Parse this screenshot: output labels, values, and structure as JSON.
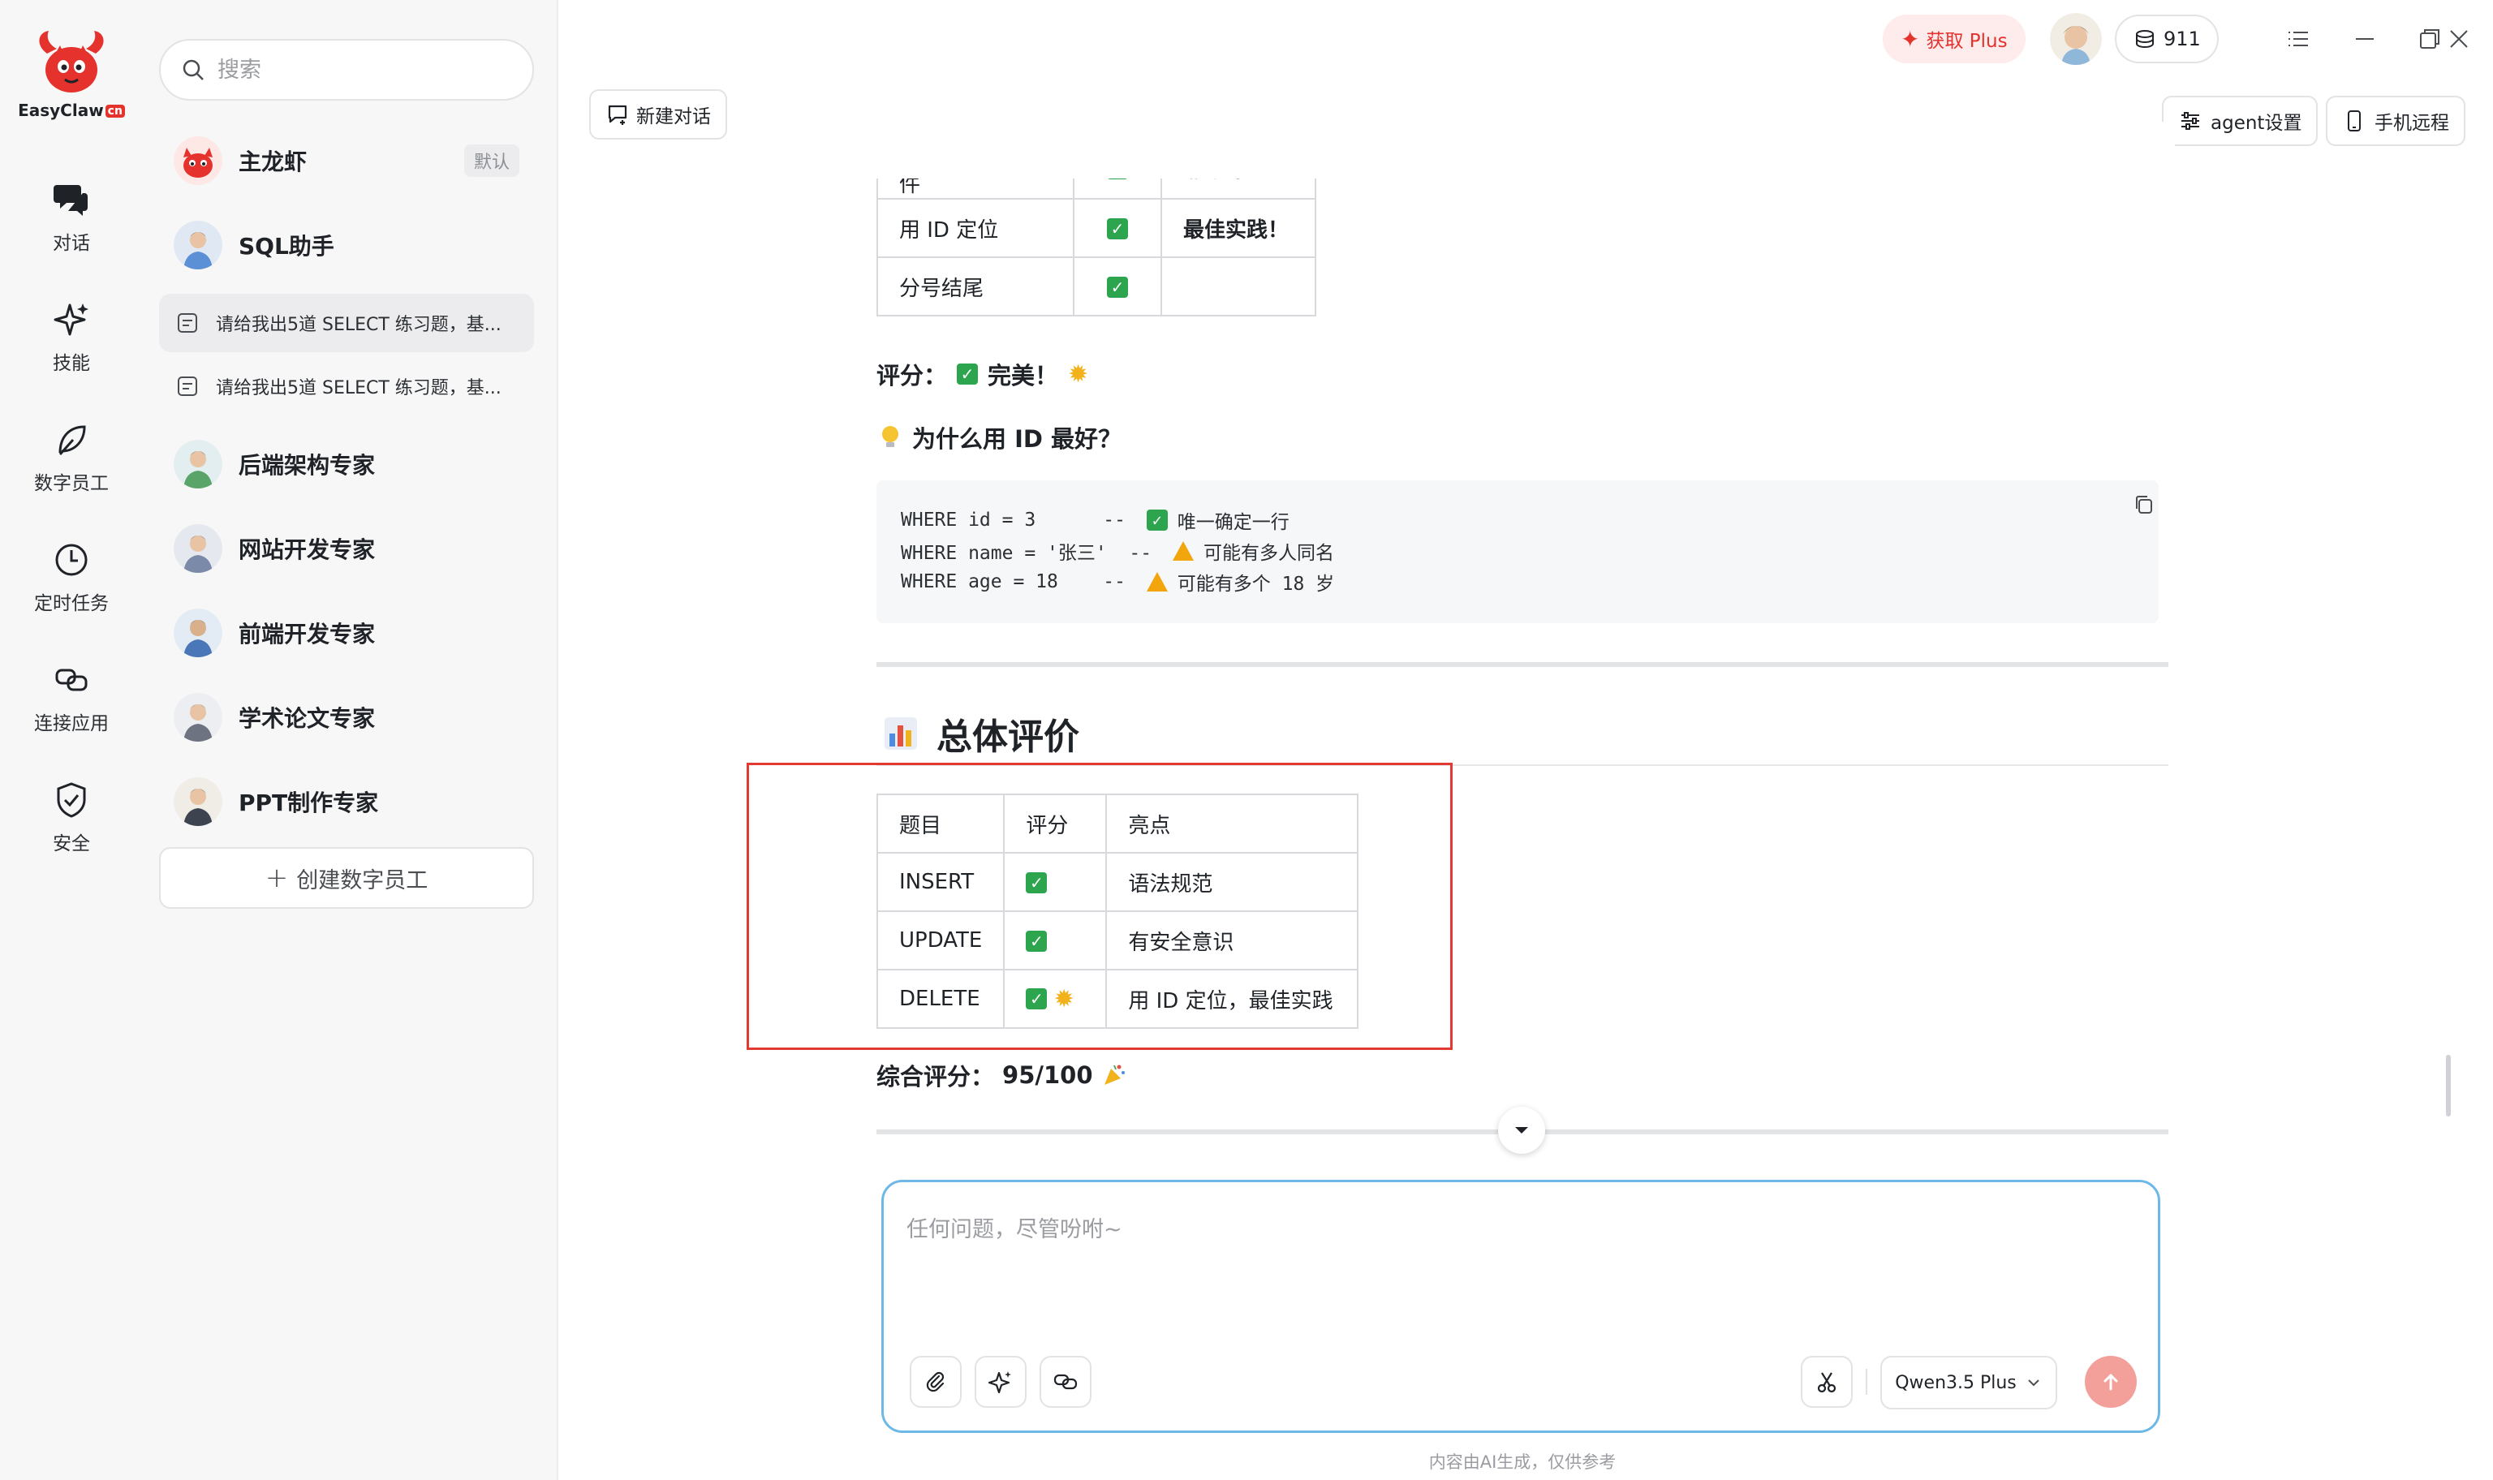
{
  "app": {
    "logo_text": "EasyClaw",
    "logo_badge": "cn"
  },
  "rail": {
    "items": [
      {
        "label": "对话",
        "icon": "chat-icon"
      },
      {
        "label": "技能",
        "icon": "sparkle-icon"
      },
      {
        "label": "数字员工",
        "icon": "leaf-icon"
      },
      {
        "label": "定时任务",
        "icon": "clock-icon"
      },
      {
        "label": "连接应用",
        "icon": "link-icon"
      },
      {
        "label": "安全",
        "icon": "shield-icon"
      }
    ]
  },
  "sidebar": {
    "search_placeholder": "搜索",
    "agents": [
      {
        "name": "主龙虾",
        "tag": "默认"
      },
      {
        "name": "SQL助手"
      },
      {
        "name": "后端架构专家"
      },
      {
        "name": "网站开发专家"
      },
      {
        "name": "前端开发专家"
      },
      {
        "name": "学术论文专家"
      },
      {
        "name": "PPT制作专家"
      }
    ],
    "conversations": [
      {
        "title": "请给我出5道 SELECT 练习题，基..."
      },
      {
        "title": "请给我出5道 SELECT 练习题，基..."
      }
    ],
    "create_label": "创建数字员工"
  },
  "topbar": {
    "new_chat": "新建对话",
    "get_plus": "获取 Plus",
    "credits": "911",
    "agent_settings": "agent设置",
    "phone_remote": "手机远程"
  },
  "message": {
    "top_table": [
      {
        "c1": "有 WHERE 条件",
        "c3": "非常好！",
        "bold": false
      },
      {
        "c1": "用 ID 定位",
        "c3": "最佳实践！",
        "bold": true
      },
      {
        "c1": "分号结尾",
        "c3": "",
        "bold": false
      }
    ],
    "score_label": "评分：",
    "score_value": "完美！",
    "why_title": "为什么用 ID 最好？",
    "code_lines": [
      {
        "code": "WHERE id = 3      -- ",
        "mark": "check",
        "comment": "唯一确定一行"
      },
      {
        "code": "WHERE name = '张三'  -- ",
        "mark": "warn",
        "comment": "可能有多人同名"
      },
      {
        "code": "WHERE age = 18    -- ",
        "mark": "warn",
        "comment": "可能有多个 18 岁"
      }
    ],
    "overall_heading": "总体评价",
    "summary_table": {
      "headers": [
        "题目",
        "评分",
        "亮点"
      ],
      "rows": [
        {
          "q": "INSERT",
          "star": false,
          "note": "语法规范"
        },
        {
          "q": "UPDATE",
          "star": false,
          "note": "有安全意识"
        },
        {
          "q": "DELETE",
          "star": true,
          "note": "用 ID 定位，最佳实践"
        }
      ]
    },
    "overall_label": "综合评分：",
    "overall_value": "95/100"
  },
  "composer": {
    "placeholder": "任何问题，尽管吩咐~",
    "model": "Qwen3.5 Plus",
    "disclaimer": "内容由AI生成，仅供参考"
  },
  "colors": {
    "accent": "#e5322d",
    "check": "#2da44e",
    "focus": "#6db8e6",
    "send": "#f4a09a"
  }
}
